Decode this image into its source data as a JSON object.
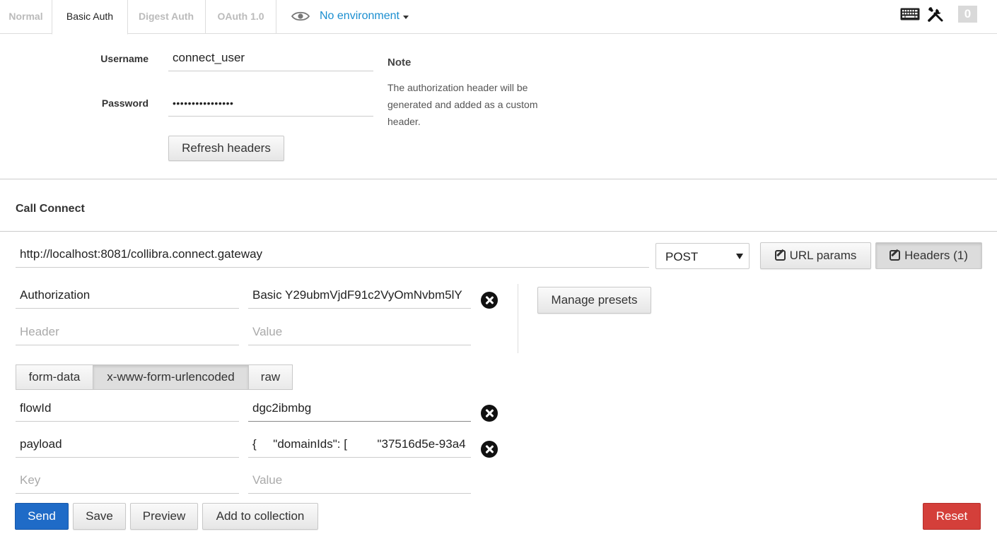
{
  "tabs": [
    {
      "label": "Normal"
    },
    {
      "label": "Basic Auth"
    },
    {
      "label": "Digest Auth"
    },
    {
      "label": "OAuth 1.0"
    }
  ],
  "environment": {
    "label": "No environment",
    "icon": "eye-icon"
  },
  "toolbar": {
    "keyboard_icon": "keyboard-icon",
    "tools_icon": "wrench-screwdriver-icon",
    "count": "0"
  },
  "auth": {
    "username_label": "Username",
    "username_value": "connect_user",
    "password_label": "Password",
    "password_value": "••••••••••••••••",
    "refresh_button": "Refresh headers",
    "note_title": "Note",
    "note_body": "The authorization header will be generated and added as a custom header."
  },
  "request": {
    "section_title": "Call Connect",
    "url": "http://localhost:8081/collibra.connect.gateway",
    "method": "POST",
    "url_params_button": "URL params",
    "headers_button": "Headers (1)"
  },
  "headers": {
    "rows": [
      {
        "key": "Authorization",
        "value": "Basic Y29ubmVjdF91c2VyOmNvbm5lY"
      }
    ],
    "key_placeholder": "Header",
    "value_placeholder": "Value",
    "manage_presets_button": "Manage presets"
  },
  "body": {
    "modes": [
      "form-data",
      "x-www-form-urlencoded",
      "raw"
    ],
    "active_mode": "x-www-form-urlencoded",
    "rows": [
      {
        "key": "flowId",
        "value": "dgc2ibmbg"
      },
      {
        "key": "payload",
        "value": "{     \"domainIds\": [         \"37516d5e-93a4"
      }
    ],
    "key_placeholder": "Key",
    "value_placeholder": "Value"
  },
  "actions": {
    "send": "Send",
    "save": "Save",
    "preview": "Preview",
    "add_to_collection": "Add to collection",
    "reset": "Reset"
  },
  "colors": {
    "accent": "#1a8ed0",
    "send": "#1f6bc7",
    "reset": "#d43f3a"
  }
}
